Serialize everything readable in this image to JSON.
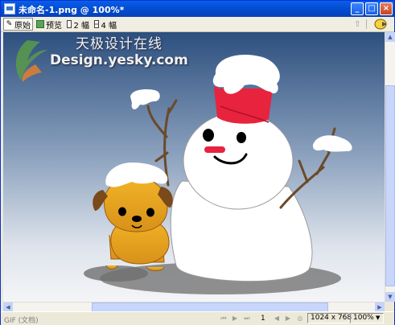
{
  "window": {
    "title": "未命名-1.png @ 100%*",
    "controls": [
      "_",
      "□",
      "×"
    ]
  },
  "toolbar": {
    "original_label": "原始",
    "preview_label": "预览",
    "two_up_label": "2 幅",
    "four_up_label": "4 幅"
  },
  "watermark": {
    "cn": "天极设计在线",
    "en": "Design.yesky.com"
  },
  "statusbar": {
    "format": "GIF (文档)",
    "page": "1",
    "dimensions": "1024 x 768",
    "zoom": "100%"
  },
  "colors": {
    "titlebar": "#0450d6",
    "canvas_top": "#2c4f7e",
    "canvas_bottom": "#f2f3f6",
    "bucket": "#e8233d",
    "dog": "#e7a21c"
  }
}
